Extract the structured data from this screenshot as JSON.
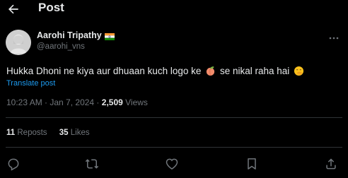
{
  "header": {
    "title": "Post",
    "back_icon": "arrow-left-icon"
  },
  "author": {
    "display_name": "Aarohi Tripathy",
    "handle": "@aarohi_vns",
    "flag_icon": "india-flag-icon"
  },
  "tweet": {
    "text_before": "Hukka Dhoni ne kiya aur dhuaan kuch logo ke",
    "emoji_1": "peach-emoji",
    "text_after": "se nikal raha hai",
    "emoji_2": "smirking-hand-over-mouth-emoji",
    "translate_label": "Translate post"
  },
  "meta": {
    "time": "10:23 AM",
    "separator": " · ",
    "date": "Jan 7, 2024",
    "views_count": "2,509",
    "views_label": "Views"
  },
  "stats": {
    "reposts_count": "11",
    "reposts_label": "Reposts",
    "likes_count": "35",
    "likes_label": "Likes"
  },
  "actions": [
    "reply-icon",
    "repost-icon",
    "like-icon",
    "bookmark-icon",
    "share-icon"
  ],
  "colors": {
    "background": "#000000",
    "text": "#e7e9ea",
    "secondary": "#71767b",
    "link": "#1d9bf0",
    "divider": "#2f3336"
  }
}
